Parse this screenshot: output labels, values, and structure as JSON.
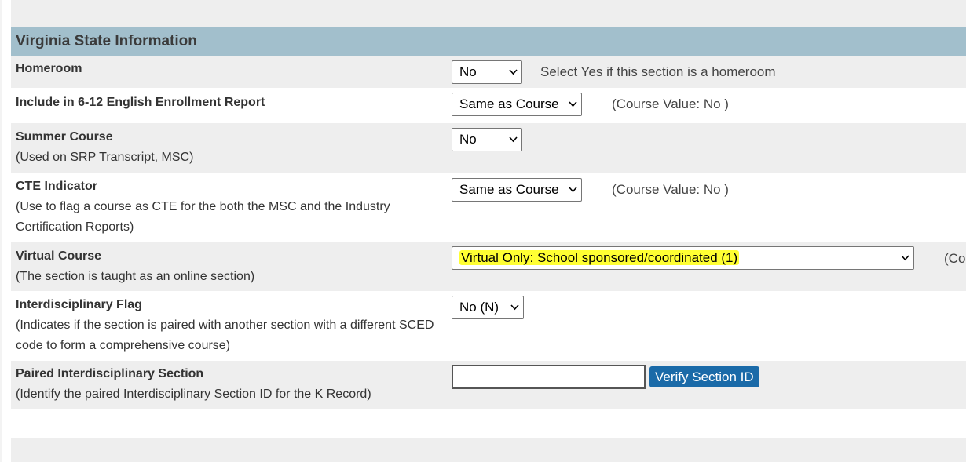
{
  "section": {
    "title": "Virginia State Information"
  },
  "fields": {
    "homeroom": {
      "title": "Homeroom",
      "value": "No",
      "note": "Select Yes if this section is a homeroom"
    },
    "english_enrollment": {
      "title": "Include in 6-12 English Enrollment Report",
      "value": "Same as Course",
      "note": "(Course Value:  No )"
    },
    "summer_course": {
      "title": "Summer Course",
      "desc": "(Used on SRP Transcript, MSC)",
      "value": "No"
    },
    "cte_indicator": {
      "title": "CTE Indicator",
      "desc": "(Use to flag a course as CTE for the both the MSC and the Industry Certification Reports)",
      "value": "Same as Course",
      "note": "(Course Value:  No )"
    },
    "virtual_course": {
      "title": "Virtual Course",
      "desc": "(The section is taught as an online section)",
      "value": "Virtual Only: School sponsored/coordinated (1)",
      "note": "(Co",
      "highlight_color": "#ffff33"
    },
    "interdisciplinary_flag": {
      "title": "Interdisciplinary Flag",
      "desc": "(Indicates if the section is paired with another section with a different SCED code to form a comprehensive course)",
      "value": "No (N)"
    },
    "paired_section": {
      "title": "Paired Interdisciplinary Section",
      "desc": "(Identify the paired Interdisciplinary Section ID for the K Record)",
      "input_value": "",
      "button_label": "Verify Section ID"
    }
  },
  "colors": {
    "header_bg": "#a2bfcc",
    "row_alt_bg": "#eeeeee",
    "button_bg": "#1a6aa8"
  }
}
